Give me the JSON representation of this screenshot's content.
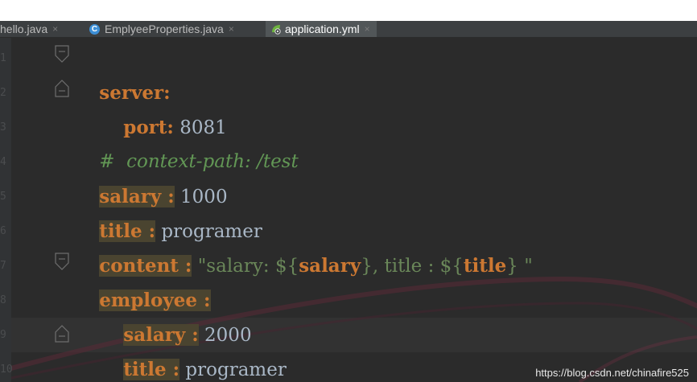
{
  "tabs": [
    {
      "label": "hello.java",
      "icon": "java-file-icon"
    },
    {
      "label": "EmplyeeProperties.java",
      "icon": "class-c-icon"
    },
    {
      "label": "application.yml",
      "icon": "yaml-spring-icon",
      "active": true
    }
  ],
  "close_glyph": "×",
  "line_numbers": [
    "1",
    "2",
    "3",
    "4",
    "5",
    "6",
    "7",
    "8",
    "9",
    "10"
  ],
  "code": {
    "l1_key": "server:",
    "l2_key": "port:",
    "l2_val": " 8081",
    "l3_comment": "#  context-path: /test",
    "l4_key": "salary :",
    "l4_val": " 1000",
    "l5_key": "title :",
    "l5_val": " programer",
    "l6_key": "content :",
    "l6_str_a": " \"salary: $",
    "l6_brace_open": "{",
    "l6_ph1": "salary",
    "l6_brace_close": "}",
    "l6_str_b": ", title : $",
    "l6_ph2": "title",
    "l6_str_c": " \"",
    "l7_key": "employee :",
    "l8_key": "salary :",
    "l8_val": " 2000",
    "l9_key": "title :",
    "l9_val": " programer"
  },
  "watermark": "https://blog.csdn.net/chinafire525",
  "colors": {
    "editor_bg": "#2b2b2b",
    "keyword": "#cc7832",
    "value": "#a9b7c6",
    "comment": "#629755",
    "string": "#6a8759",
    "highlight": "#4a4430"
  }
}
